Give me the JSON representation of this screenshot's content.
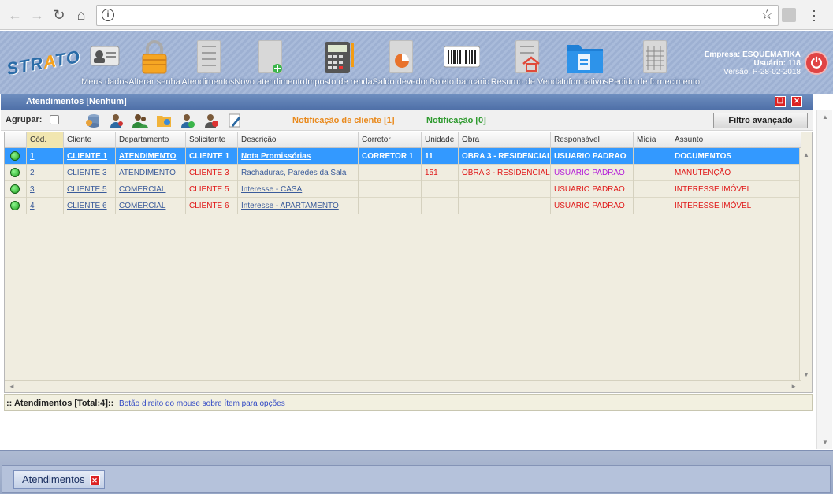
{
  "toolbar": {
    "items": [
      {
        "label": "Meus dados",
        "icon": "id-card-icon"
      },
      {
        "label": "Alterar senha",
        "icon": "padlock-icon"
      },
      {
        "label": "Atendimentos",
        "icon": "document-icon"
      },
      {
        "label": "Novo atendimento",
        "icon": "new-document-icon"
      },
      {
        "label": "Imposto de renda",
        "icon": "calculator-icon"
      },
      {
        "label": "Saldo devedor",
        "icon": "pie-chart-document-icon"
      },
      {
        "label": "Boleto bancário",
        "icon": "barcode-icon"
      },
      {
        "label": "Resumo de Venda",
        "icon": "house-document-icon"
      },
      {
        "label": "Informativos",
        "icon": "folder-icon"
      },
      {
        "label": "Pedido de fornecimento",
        "icon": "spreadsheet-icon"
      }
    ]
  },
  "logo": {
    "text_a": "STR",
    "text_b": "A",
    "text_c": "TO"
  },
  "company": {
    "empresa": "Empresa: ESQUEMÁTIKA",
    "usuario": "Usuário: 118",
    "versao": "Versão: P-28-02-2018"
  },
  "window": {
    "title": "Atendimentos [Nenhum]"
  },
  "filters": {
    "agrupar": "Agrupar:",
    "notif_cliente": "Notificação de cliente [1]",
    "notificacao": "Notificação [0]",
    "filtro_btn": "Filtro avançado"
  },
  "grid": {
    "headers": [
      "Cód.",
      "Cliente",
      "Departamento",
      "Solicitante",
      "Descrição",
      "Corretor",
      "Unidade",
      "Obra",
      "Responsável",
      "Mídia",
      "Assunto"
    ],
    "rows": [
      {
        "cod": "1",
        "cliente": "CLIENTE 1",
        "departamento": "ATENDIMENTO",
        "solicitante": "CLIENTE 1",
        "descricao": "Nota Promissórias",
        "corretor": "CORRETOR 1",
        "unidade": "11",
        "obra": "OBRA 3 - RESIDENCIAL",
        "responsavel": "USUARIO PADRAO",
        "midia": "",
        "assunto": "DOCUMENTOS"
      },
      {
        "cod": "2",
        "cliente": "CLIENTE 3",
        "departamento": "ATENDIMENTO",
        "solicitante": "CLIENTE 3",
        "descricao": "Rachaduras, Paredes da Sala",
        "corretor": "",
        "unidade": "151",
        "obra": "OBRA 3 - RESIDENCIAL",
        "responsavel": "USUARIO PADRAO",
        "midia": "",
        "assunto": "MANUTENÇÃO"
      },
      {
        "cod": "3",
        "cliente": "CLIENTE 5",
        "departamento": "COMERCIAL",
        "solicitante": "CLIENTE 5",
        "descricao": "Interesse - CASA",
        "corretor": "",
        "unidade": "",
        "obra": "",
        "responsavel": "USUARIO PADRAO",
        "midia": "",
        "assunto": "INTERESSE IMÓVEL"
      },
      {
        "cod": "4",
        "cliente": "CLIENTE 6",
        "departamento": "COMERCIAL",
        "solicitante": "CLIENTE 6",
        "descricao": "Interesse - APARTAMENTO",
        "corretor": "",
        "unidade": "",
        "obra": "",
        "responsavel": "USUARIO PADRAO",
        "midia": "",
        "assunto": "INTERESSE IMÓVEL"
      }
    ]
  },
  "status": {
    "total": ":: Atendimentos [Total:4]::",
    "hint": "Botão direito do mouse sobre ítem para opções"
  },
  "taskbar": {
    "tab_label": "Atendimentos"
  },
  "colors": {
    "selected_row": "#3399ff",
    "red_text": "#e01818",
    "purple_text": "#b41bd8",
    "header_bg": "#9db0d2"
  }
}
